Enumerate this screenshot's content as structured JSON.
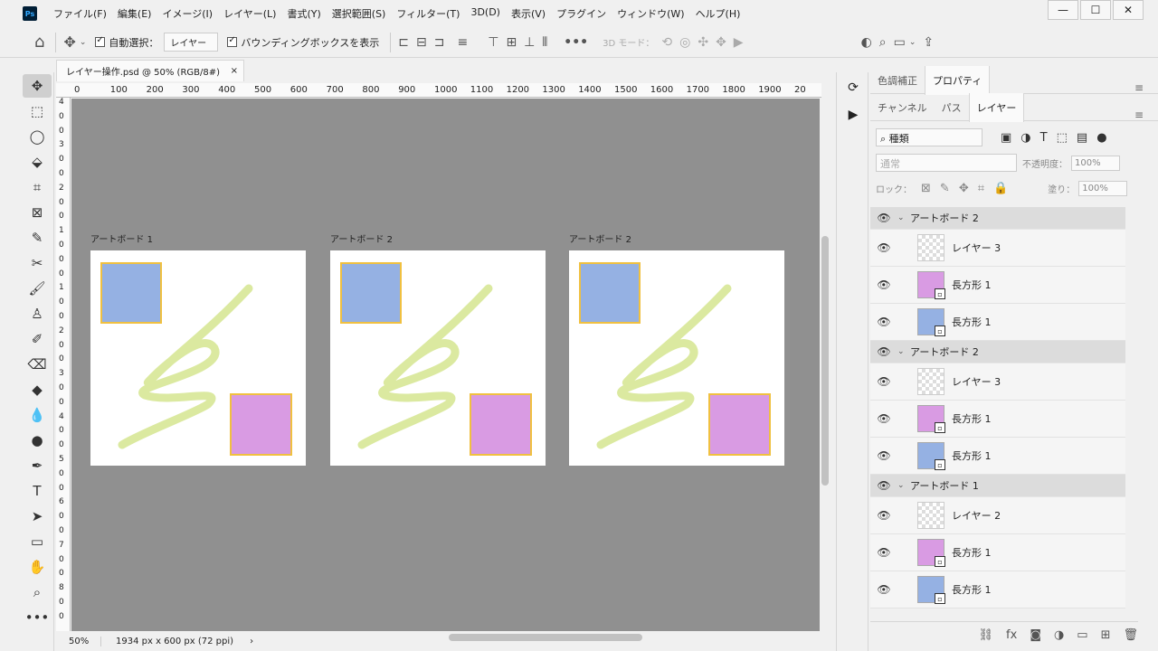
{
  "app": {
    "logo_text": "Ps"
  },
  "menus": [
    "ファイル(F)",
    "編集(E)",
    "イメージ(I)",
    "レイヤー(L)",
    "書式(Y)",
    "選択範囲(S)",
    "フィルター(T)",
    "3D(D)",
    "表示(V)",
    "プラグイン",
    "ウィンドウ(W)",
    "ヘルプ(H)"
  ],
  "window_controls": {
    "minimize": "—",
    "maximize": "☐",
    "close": "✕"
  },
  "options": {
    "auto_select_label": "自動選択：",
    "auto_select_target": "レイヤー",
    "show_bounding_box_label": "バウンディングボックスを表示",
    "more": "•••",
    "mode_3d_label": "3D モード："
  },
  "document": {
    "tab_title": "レイヤー操作.psd @ 50% (RGB/8#)",
    "close": "×",
    "zoom": "50%",
    "info": "1934 px x 600 px (72 ppi)",
    "info_arrow": "›"
  },
  "ruler": {
    "h_labels": [
      "0",
      "100",
      "200",
      "300",
      "400",
      "500",
      "600",
      "700",
      "800",
      "900",
      "1000",
      "1100",
      "1200",
      "1300",
      "1400",
      "1500",
      "1600",
      "1700",
      "1800",
      "1900",
      "20"
    ],
    "v_labels": [
      "4",
      "0",
      "0",
      "3",
      "0",
      "0",
      "2",
      "0",
      "0",
      "1",
      "0",
      "0",
      "0",
      "1",
      "0",
      "0",
      "2",
      "0",
      "0",
      "3",
      "0",
      "0",
      "4",
      "0",
      "0",
      "5",
      "0",
      "0",
      "6",
      "0",
      "0",
      "7",
      "0",
      "0",
      "8",
      "0",
      "0"
    ]
  },
  "artboards": [
    {
      "label": "アートボード 1"
    },
    {
      "label": "アートボード 2"
    },
    {
      "label": "アートボード 2"
    }
  ],
  "colors": {
    "blue_rect": "#95b1e3",
    "pink_rect": "#d99be3",
    "rect_border": "#f0c040",
    "stroke": "#dbe9a0",
    "canvas_bg": "#909090"
  },
  "panel": {
    "top_tabs": [
      "色調補正",
      "プロパティ"
    ],
    "tabs": [
      "チャンネル",
      "パス",
      "レイヤー"
    ],
    "filter_kind": "種類",
    "blend_mode": "通常",
    "opacity_label": "不透明度：",
    "opacity_value": "100%",
    "lock_label": "ロック：",
    "fill_label": "塗り：",
    "fill_value": "100%",
    "menu": "≡"
  },
  "layers": [
    {
      "type": "group",
      "name": "アートボード 2"
    },
    {
      "type": "layer",
      "name": "レイヤー 3",
      "thumb": "trans"
    },
    {
      "type": "layer",
      "name": "長方形 1",
      "thumb": "pink"
    },
    {
      "type": "layer",
      "name": "長方形 1",
      "thumb": "blue"
    },
    {
      "type": "group",
      "name": "アートボード 2"
    },
    {
      "type": "layer",
      "name": "レイヤー 3",
      "thumb": "trans"
    },
    {
      "type": "layer",
      "name": "長方形 1",
      "thumb": "pink"
    },
    {
      "type": "layer",
      "name": "長方形 1",
      "thumb": "blue"
    },
    {
      "type": "group",
      "name": "アートボード 1"
    },
    {
      "type": "layer",
      "name": "レイヤー 2",
      "thumb": "trans"
    },
    {
      "type": "layer",
      "name": "長方形 1",
      "thumb": "pink"
    },
    {
      "type": "layer",
      "name": "長方形 1",
      "thumb": "blue"
    }
  ]
}
